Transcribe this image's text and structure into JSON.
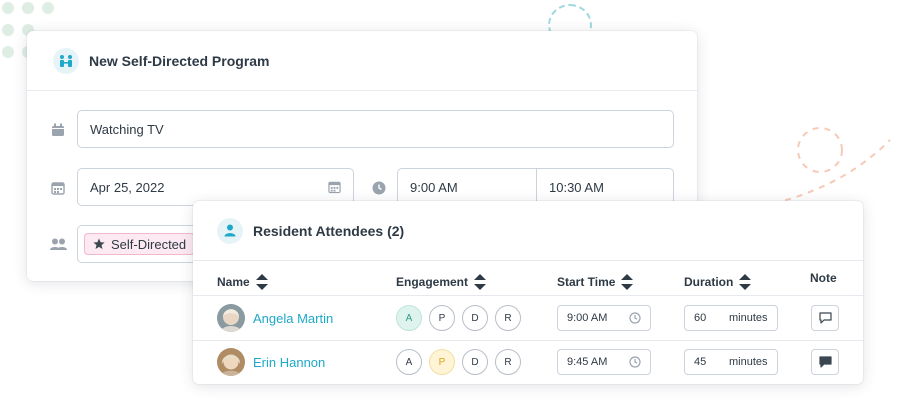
{
  "program": {
    "title": "New Self-Directed Program",
    "activity": "Watching TV",
    "date": "Apr 25, 2022",
    "start_time": "9:00 AM",
    "end_time": "10:30 AM",
    "tag": "Self-Directed"
  },
  "attendees": {
    "title": "Resident Attendees (2)",
    "columns": {
      "name": "Name",
      "engagement": "Engagement",
      "start_time": "Start Time",
      "duration": "Duration",
      "note": "Note"
    },
    "engagement_options": [
      "A",
      "P",
      "D",
      "R"
    ],
    "duration_unit": "minutes",
    "rows": [
      {
        "name": "Angela Martin",
        "engagement": "A",
        "start_time": "9:00 AM",
        "duration": "60",
        "has_note": false
      },
      {
        "name": "Erin Hannon",
        "engagement": "P",
        "start_time": "9:45 AM",
        "duration": "45",
        "has_note": true
      }
    ]
  },
  "colors": {
    "accent": "#1ea8c9",
    "tag_bg": "#fde9f1",
    "engaged_a": "#dff3ee",
    "engaged_p": "#fff5d6"
  }
}
